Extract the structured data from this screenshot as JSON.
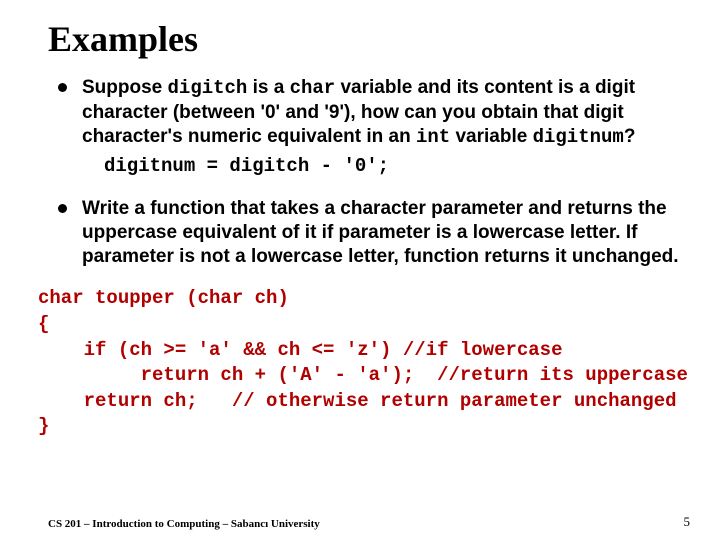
{
  "title": "Examples",
  "bullet1": {
    "pre1": "Suppose ",
    "code1": "digitch",
    "mid1": " is a ",
    "code2": "char",
    "mid2": " variable and its content is a digit character (between '0' and '9'), how can you obtain that digit character's numeric equivalent in an ",
    "code3": "int",
    "mid3": " variable ",
    "code4": "digitnum",
    "end": "?",
    "codeline": "digitnum = digitch - '0';"
  },
  "bullet2": {
    "text": "Write a function that takes a character parameter and returns the uppercase equivalent of it if parameter is a lowercase letter. If parameter is not a lowercase letter, function returns it unchanged."
  },
  "codeblock": "char toupper (char ch)\n{\n    if (ch >= 'a' && ch <= 'z') //if lowercase\n         return ch + ('A' - 'a');  //return its uppercase\n    return ch;   // otherwise return parameter unchanged\n}",
  "footer": "CS 201 – Introduction to Computing – Sabancı University",
  "pagenum": "5"
}
